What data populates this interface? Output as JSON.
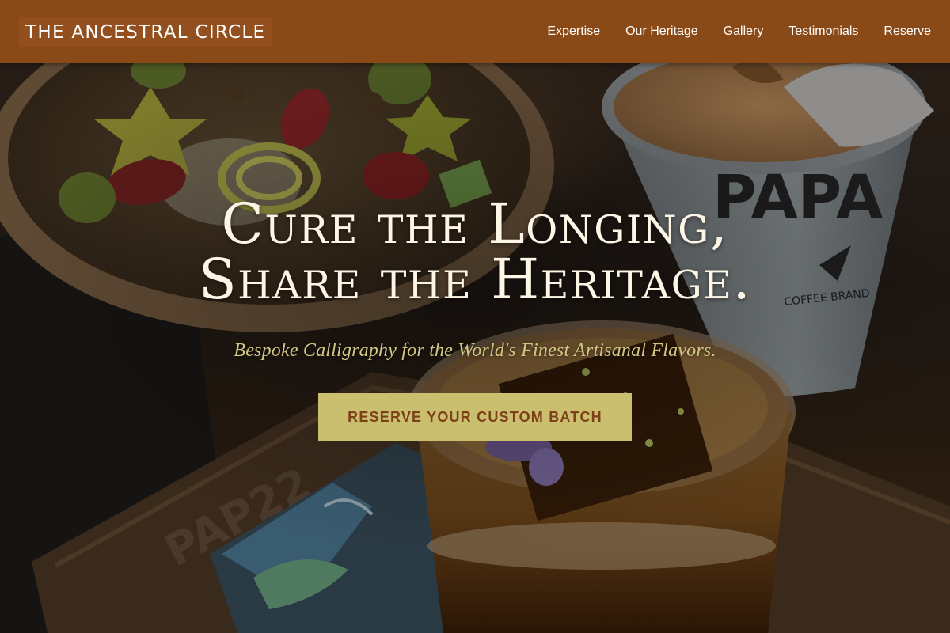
{
  "header": {
    "brand": "THE ANCESTRAL CIRCLE",
    "nav": [
      {
        "label": "Expertise"
      },
      {
        "label": "Our Heritage"
      },
      {
        "label": "Gallery"
      },
      {
        "label": "Testimonials"
      },
      {
        "label": "Reserve"
      }
    ]
  },
  "hero": {
    "headline_line1": "Cure the Longing,",
    "headline_line2": "Share the Heritage.",
    "tagline": "Bespoke Calligraphy for the World's Finest Artisanal Flavors.",
    "cta_label": "RESERVE YOUR CUSTOM BATCH",
    "background_image": "Overhead photo of a fruit and granola bowl, a PAPA coffee cup, a layered iced drink and a painted card on a wooden tray with a dark tint",
    "cup_text": "PAPA",
    "cup_subtext": "COFFEE BRAND",
    "tray_text": "PAP22"
  },
  "colors": {
    "header_bg": "#8a4a17",
    "brand_bg": "#93501e",
    "nav_text": "#ffffff",
    "headline": "#fdf6e6",
    "tagline": "#d2c784",
    "cta_bg": "#c9bf6e",
    "cta_text": "#7e4018"
  },
  "icons": {
    "cup_logo": "paper-plane-icon"
  }
}
